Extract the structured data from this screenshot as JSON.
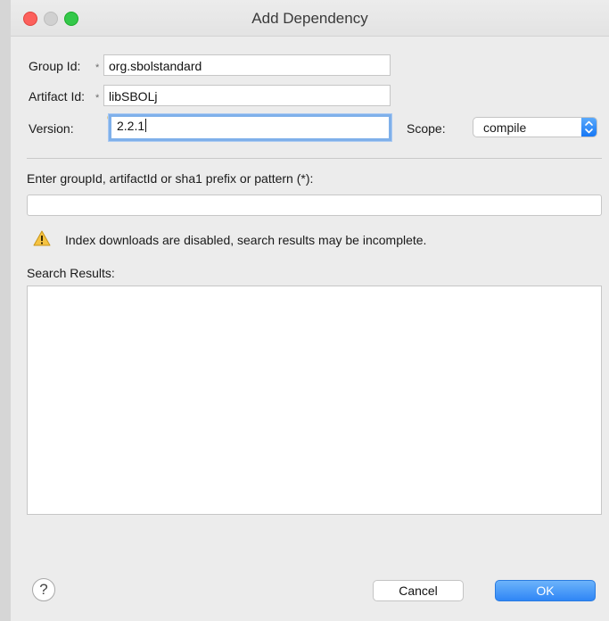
{
  "window": {
    "title": "Add Dependency"
  },
  "form": {
    "group_id": {
      "label": "Group Id:",
      "value": "org.sbolstandard",
      "required_marker": "*"
    },
    "artifact_id": {
      "label": "Artifact Id:",
      "value": "libSBOLj",
      "required_marker": "*"
    },
    "version": {
      "label": "Version:",
      "value": "2.2.1"
    },
    "scope": {
      "label": "Scope:",
      "value": "compile"
    }
  },
  "search": {
    "label": "Enter groupId, artifactId or sha1 prefix or pattern (*):",
    "value": "",
    "warning_text": "Index downloads are disabled, search results may be incomplete.",
    "results_label": "Search Results:"
  },
  "footer": {
    "help_icon": "question-mark-icon",
    "help_glyph": "?",
    "cancel_label": "Cancel",
    "ok_label": "OK"
  },
  "colors": {
    "accent": "#2f86f6",
    "close": "#fc605c",
    "zoom": "#34c84a",
    "warning": "#f5c342"
  }
}
